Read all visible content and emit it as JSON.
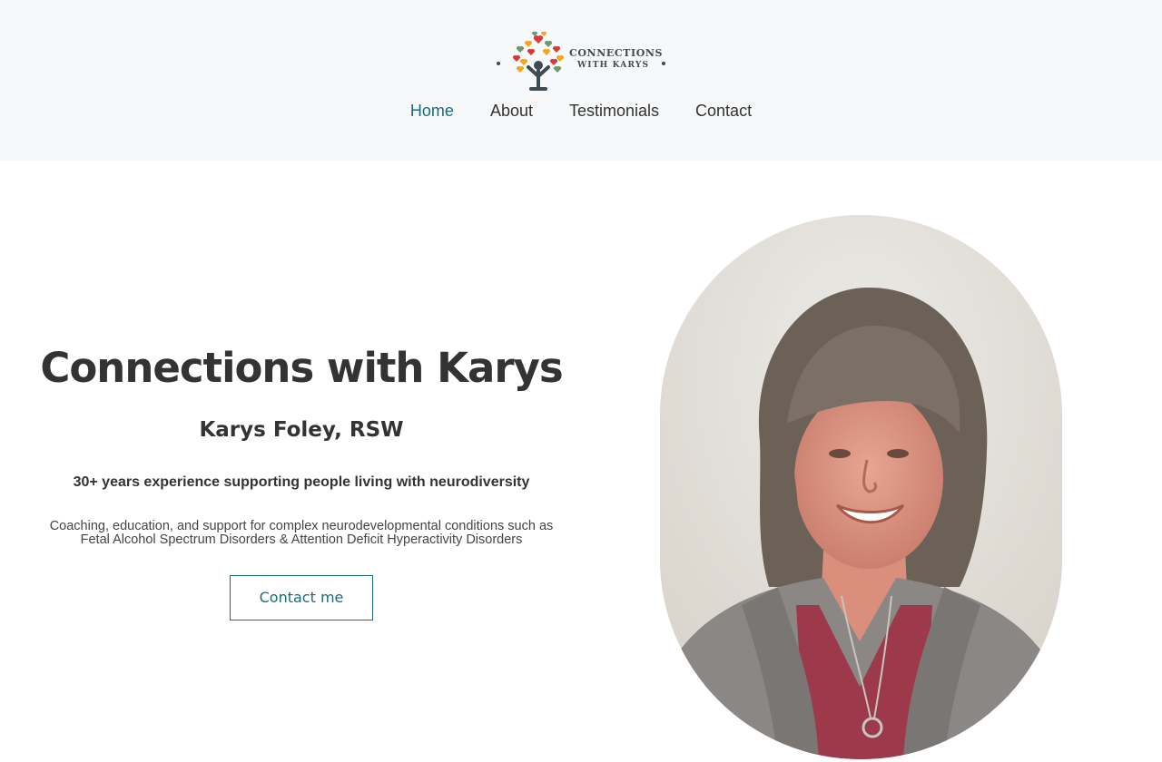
{
  "header": {
    "logo": {
      "line1": "CONNECTIONS",
      "line2": "WITH KARYS",
      "icon": "heart-tree-logo"
    },
    "nav": [
      {
        "label": "Home",
        "active": true
      },
      {
        "label": "About",
        "active": false
      },
      {
        "label": "Testimonials",
        "active": false
      },
      {
        "label": "Contact",
        "active": false
      }
    ]
  },
  "hero": {
    "title": "Connections with Karys",
    "subtitle": "Karys Foley, RSW",
    "experience": "30+ years experience supporting people living with neurodiversity",
    "description": "Coaching, education, and support for complex neurodevelopmental conditions such as Fetal Alcohol Spectrum Disorders & Attention Deficit Hyperactivity Disorders",
    "cta_label": "Contact me"
  },
  "portrait": {
    "subject": "portrait-photo"
  },
  "colors": {
    "accent": "#1d6a7c",
    "header_bg": "#f7f8f9",
    "text": "#333333"
  }
}
